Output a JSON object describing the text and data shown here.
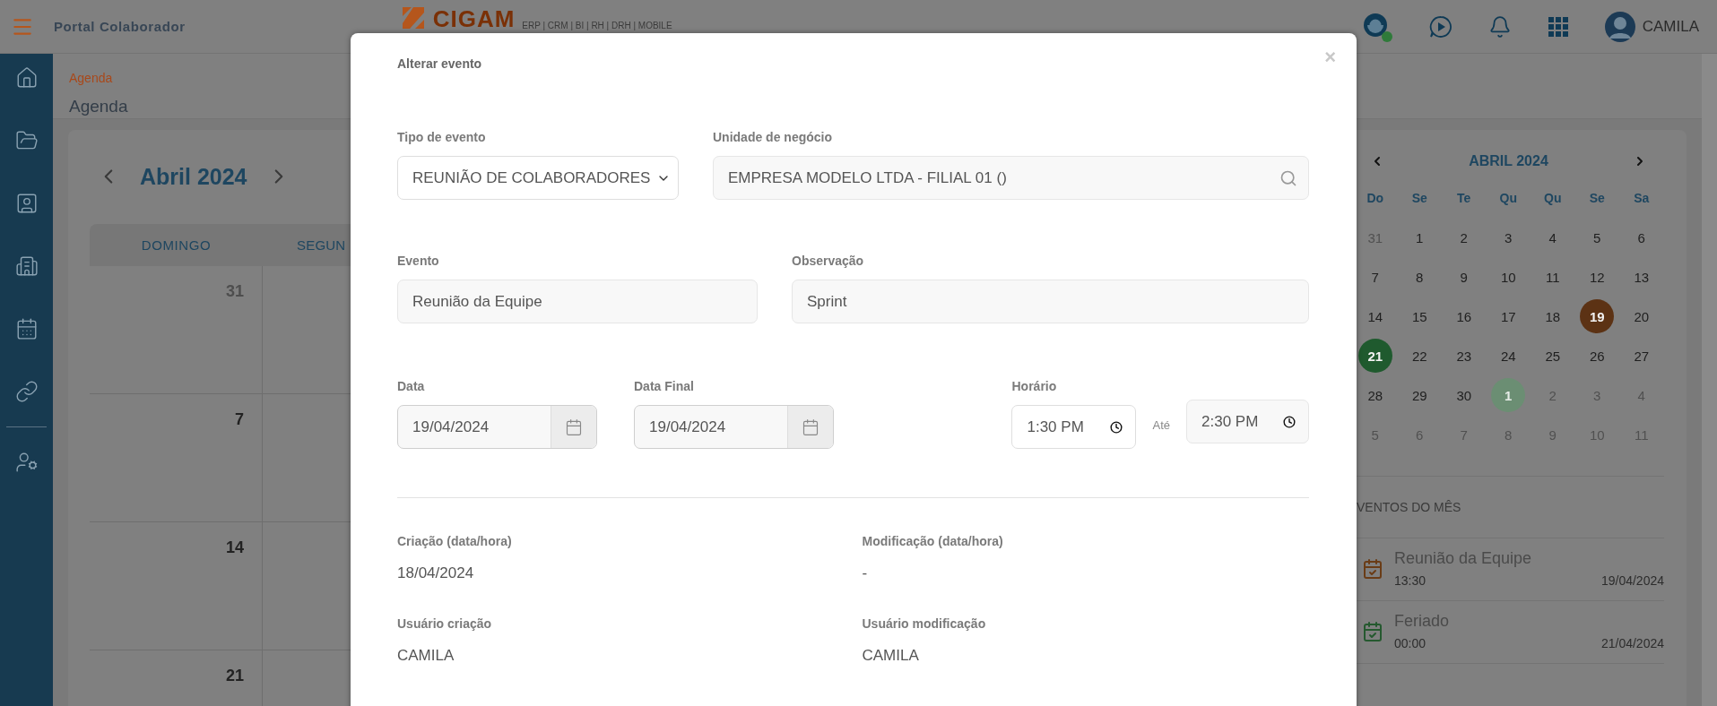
{
  "top_bar": {
    "title": "Portal Colaborador",
    "logo": "CIGAM",
    "logo_subtitle": "ERP | CRM | BI | RH | DRH | MOBILE",
    "user": "CAMILA"
  },
  "breadcrumb": "Agenda",
  "page_title": "Agenda",
  "calendar": {
    "month": "Abril 2024",
    "columns": [
      "DOMINGO",
      "SEGUN"
    ],
    "weeks": [
      {
        "day": "31",
        "other_month": true
      },
      {
        "day": "7",
        "other_month": false
      },
      {
        "day": "14",
        "other_month": false
      },
      {
        "day": "21",
        "other_month": false
      }
    ]
  },
  "mini_calendar": {
    "month": "ABRIL 2024",
    "weekdays": [
      "Do",
      "Se",
      "Te",
      "Qu",
      "Qu",
      "Se",
      "Sa"
    ],
    "weeks": [
      [
        {
          "day": "31",
          "other_month": true
        },
        {
          "day": "1",
          "other_month": false
        },
        {
          "day": "2",
          "other_month": false
        },
        {
          "day": "3",
          "other_month": false
        },
        {
          "day": "4",
          "other_month": false
        },
        {
          "day": "5",
          "other_month": false
        },
        {
          "day": "6",
          "other_month": false
        }
      ],
      [
        {
          "day": "7",
          "other_month": false
        },
        {
          "day": "8",
          "other_month": false
        },
        {
          "day": "9",
          "other_month": false
        },
        {
          "day": "10",
          "other_month": false
        },
        {
          "day": "11",
          "other_month": false
        },
        {
          "day": "12",
          "other_month": false
        },
        {
          "day": "13",
          "other_month": false
        }
      ],
      [
        {
          "day": "14",
          "other_month": false
        },
        {
          "day": "15",
          "other_month": false
        },
        {
          "day": "16",
          "other_month": false
        },
        {
          "day": "17",
          "other_month": false
        },
        {
          "day": "18",
          "other_month": false
        },
        {
          "day": "19",
          "other_month": false,
          "color": "#5c3214"
        },
        {
          "day": "20",
          "other_month": false
        }
      ],
      [
        {
          "day": "21",
          "other_month": false,
          "color": "#1f5a2e"
        },
        {
          "day": "22",
          "other_month": false
        },
        {
          "day": "23",
          "other_month": false
        },
        {
          "day": "24",
          "other_month": false
        },
        {
          "day": "25",
          "other_month": false
        },
        {
          "day": "26",
          "other_month": false
        },
        {
          "day": "27",
          "other_month": false
        }
      ],
      [
        {
          "day": "28",
          "other_month": false
        },
        {
          "day": "29",
          "other_month": false
        },
        {
          "day": "30",
          "other_month": false
        },
        {
          "day": "1",
          "other_month": true,
          "color": "#6b8e73"
        },
        {
          "day": "2",
          "other_month": true
        },
        {
          "day": "3",
          "other_month": true
        },
        {
          "day": "4",
          "other_month": true
        }
      ],
      [
        {
          "day": "5",
          "other_month": true
        },
        {
          "day": "6",
          "other_month": true
        },
        {
          "day": "7",
          "other_month": true
        },
        {
          "day": "8",
          "other_month": true
        },
        {
          "day": "9",
          "other_month": true
        },
        {
          "day": "10",
          "other_month": true
        },
        {
          "day": "11",
          "other_month": true
        }
      ]
    ]
  },
  "events_heading": "VENTOS DO MÊS",
  "events": [
    {
      "title": "Reunião da Equipe",
      "time": "13:30",
      "date": "19/04/2024",
      "color": "#6a3c16"
    },
    {
      "title": "Feriado",
      "time": "00:00",
      "date": "21/04/2024",
      "color": "#25592f"
    }
  ],
  "modal": {
    "title": "Alterar evento",
    "close": "×",
    "event_type": {
      "label": "Tipo de evento",
      "value": "REUNIÃO DE COLABORADORES"
    },
    "business_unit": {
      "label": "Unidade de negócio",
      "value": "EMPRESA MODELO LTDA - FILIAL 01 ()"
    },
    "event": {
      "label": "Evento",
      "value": "Reunião da Equipe"
    },
    "note": {
      "label": "Observação",
      "value": "Sprint"
    },
    "start_date": {
      "label": "Data",
      "value": "19/04/2024"
    },
    "end_date": {
      "label": "Data Final",
      "value": "19/04/2024"
    },
    "time": {
      "label": "Horário",
      "from": "1:30 PM",
      "to_label": "Até",
      "to": "2:30 PM"
    },
    "info": [
      {
        "label": "Criação (data/hora)",
        "value": "18/04/2024"
      },
      {
        "label": "Modificação (data/hora)",
        "value": "-"
      },
      {
        "label": "Usuário criação",
        "value": "CAMILA"
      },
      {
        "label": "Usuário modificação",
        "value": "CAMILA"
      }
    ]
  }
}
